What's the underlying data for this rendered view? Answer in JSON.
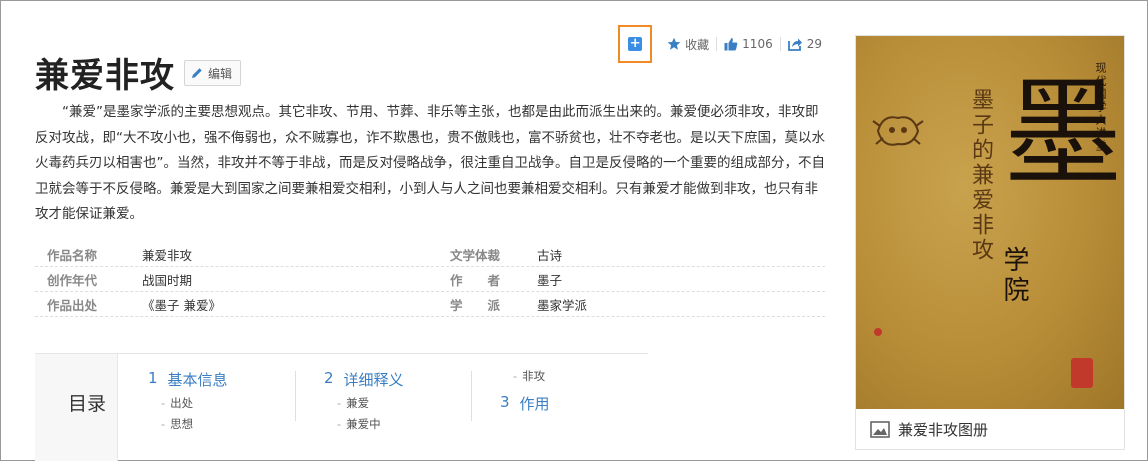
{
  "toolbar": {
    "add_label": "+",
    "favorite_label": "收藏",
    "like_count": "1106",
    "share_count": "29"
  },
  "title": "兼爱非攻",
  "edit_label": "编辑",
  "description": "“兼爱”是墨家学派的主要思想观点。其它非攻、节用、节葬、非乐等主张，也都是由此而派生出来的。兼爱便必须非攻，非攻即反对攻战，即“大不攻小也，强不侮弱也，众不贼寡也，诈不欺愚也，贵不傲贱也，富不骄贫也，壮不夺老也。是以天下庶国，莫以水火毒药兵刃以相害也”。当然，非攻并不等于非战，而是反对侵略战争，很注重自卫战争。自卫是反侵略的一个重要的组成部分，不自卫就会等于不反侵略。兼爱是大到国家之间要兼相爱交相利，小到人与人之间也要兼相爱交相利。只有兼爱才能做到非攻，也只有非攻才能保证兼爱。",
  "info": [
    {
      "label1": "作品名称",
      "value1": "兼爱非攻",
      "label2": "文学体裁",
      "value2": "古诗"
    },
    {
      "label1": "创作年代",
      "value1": "战国时期",
      "label2": "作　　者",
      "value2": "墨子"
    },
    {
      "label1": "作品出处",
      "value1": "《墨子 兼爱》",
      "label2": "学　　派",
      "value2": "墨家学派"
    }
  ],
  "catalog": {
    "title": "目录",
    "sections": [
      {
        "num": "1",
        "label": "基本信息",
        "subs": [
          "出处",
          "思想"
        ]
      },
      {
        "num": "2",
        "label": "详细释义",
        "subs": [
          "兼爱",
          "兼爱中"
        ]
      },
      {
        "num": "3",
        "label": "作用",
        "pre_sub": "非攻"
      }
    ]
  },
  "cover": {
    "series": "现代国学大讲堂",
    "subtitle": "墨子的兼爱非攻",
    "big_char": "墨",
    "college": "学院",
    "caption": "兼爱非攻图册"
  },
  "colors": {
    "accent_link": "#3a7fc4",
    "highlight_border": "#f08a24",
    "add_icon_bg": "#3a8ee6",
    "cover_gold": "#b88d38"
  },
  "icons": [
    "plus-icon",
    "star-icon",
    "thumbs-up-icon",
    "share-icon",
    "pencil-icon",
    "image-icon"
  ]
}
